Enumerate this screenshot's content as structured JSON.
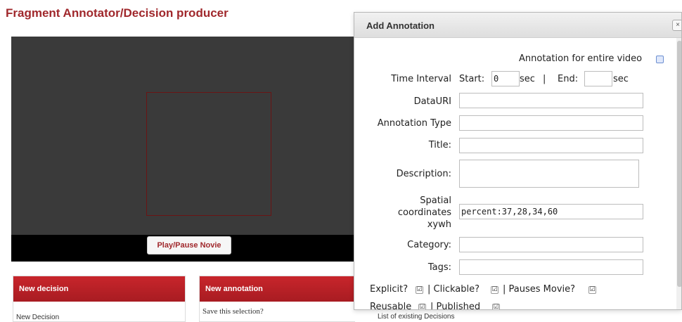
{
  "page": {
    "title": "Fragment Annotator/Decision producer",
    "play_button": "Play/Pause Novie"
  },
  "panels": {
    "decision": {
      "header": "New decision",
      "body": "New Decision"
    },
    "annotation": {
      "header": "New annotation",
      "body": "Save this selection?"
    },
    "existing_label": "List of existing Decisions"
  },
  "dialog": {
    "title": "Add Annotation",
    "close_icon": "×",
    "entire_video_label": "Annotation for entire video",
    "time_interval": {
      "label": "Time Interval",
      "start_label": "Start:",
      "start_value": "0",
      "unit1": "sec",
      "separator": "|",
      "end_label": "End:",
      "end_value": "",
      "unit2": "sec"
    },
    "data_uri": {
      "label": "DataURI",
      "value": ""
    },
    "annotation_type": {
      "label": "Annotation Type",
      "value": ""
    },
    "title_field": {
      "label": "Title:",
      "value": ""
    },
    "description": {
      "label": "Description:",
      "value": ""
    },
    "spatial": {
      "label_line1": "Spatial",
      "label_line2": "coordinates",
      "label_line3": "xywh",
      "value": "percent:37,28,34,60"
    },
    "category": {
      "label": "Category:",
      "value": ""
    },
    "tags": {
      "label": "Tags:",
      "value": ""
    },
    "flags_row1": [
      {
        "label": "Explicit?",
        "checked": true
      },
      {
        "label": "| Clickable?",
        "checked": true
      },
      {
        "label": "| Pauses Movie?",
        "checked": true
      }
    ],
    "flags_row2": [
      {
        "label": "Reusable",
        "checked": true
      },
      {
        "label": "| Published",
        "checked": true
      }
    ],
    "check_glyph": "☑"
  },
  "colors": {
    "brand": "#a0282c",
    "header_red": "#c8252b",
    "video_bg": "#3a3a3a"
  }
}
